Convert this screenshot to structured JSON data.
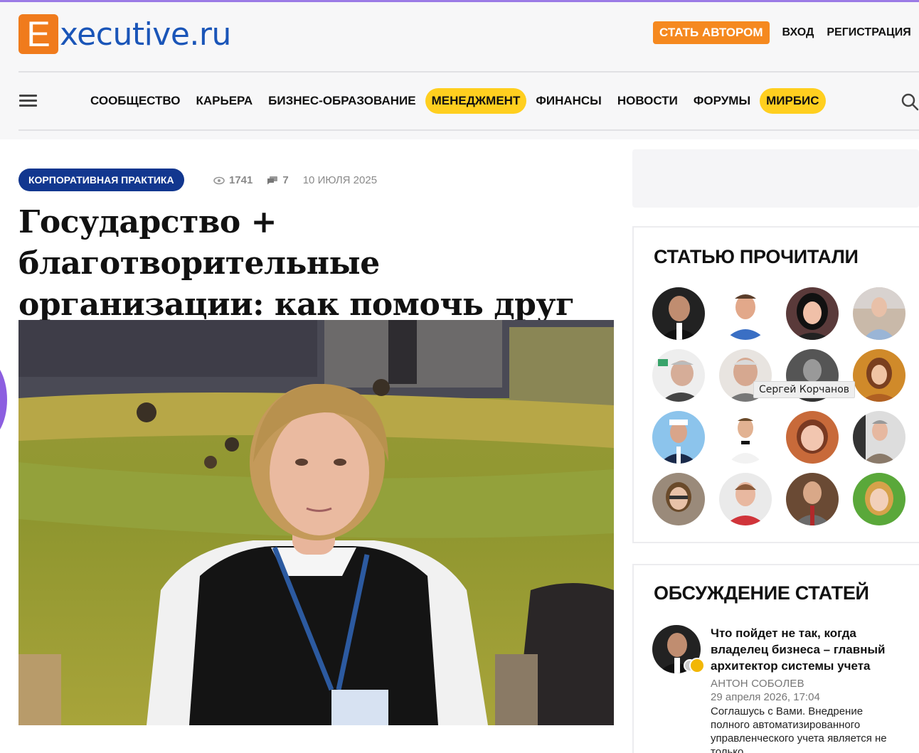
{
  "header": {
    "logo_letter": "E",
    "logo_text": "xecutive.ru",
    "become_author": "СТАТЬ АВТОРОМ",
    "login": "ВХОД",
    "register": "РЕГИСТРАЦИЯ"
  },
  "nav": {
    "items": [
      {
        "label": "СООБЩЕСТВО",
        "highlighted": false
      },
      {
        "label": "КАРЬЕРА",
        "highlighted": false
      },
      {
        "label": "БИЗНЕС-ОБРАЗОВАНИЕ",
        "highlighted": false
      },
      {
        "label": "МЕНЕДЖМЕНТ",
        "highlighted": true
      },
      {
        "label": "ФИНАНСЫ",
        "highlighted": false
      },
      {
        "label": "НОВОСТИ",
        "highlighted": false
      },
      {
        "label": "ФОРУМЫ",
        "highlighted": false
      },
      {
        "label": "МИРБИС",
        "highlighted": true
      }
    ]
  },
  "article": {
    "category": "КОРПОРАТИВНАЯ ПРАКТИКА",
    "views": "1741",
    "comments": "7",
    "date": "10 ИЮЛЯ 2025",
    "title": "Государство + благотворительные организации: как помочь друг другу"
  },
  "sidebar": {
    "readers_title": "СТАТЬЮ ПРОЧИТАЛИ",
    "tooltip": "Сергей Корчанов",
    "discussion_title": "ОБСУЖДЕНИЕ СТАТЕЙ",
    "discussion": {
      "title": "Что пойдет не так, когда владелец бизнеса – главный архитектор системы учета",
      "author": "АНТОН СОБОЛЕВ",
      "date": "29 апреля 2026, 17:04",
      "text": "Соглашусь с Вами. Внедрение полного автоматизированного управленческого учета является не только..."
    }
  },
  "colors": {
    "brand_orange": "#f07b1c",
    "brand_blue": "#1a55b8",
    "highlight_yellow": "#ffcf1f",
    "category_blue": "#12378f"
  }
}
